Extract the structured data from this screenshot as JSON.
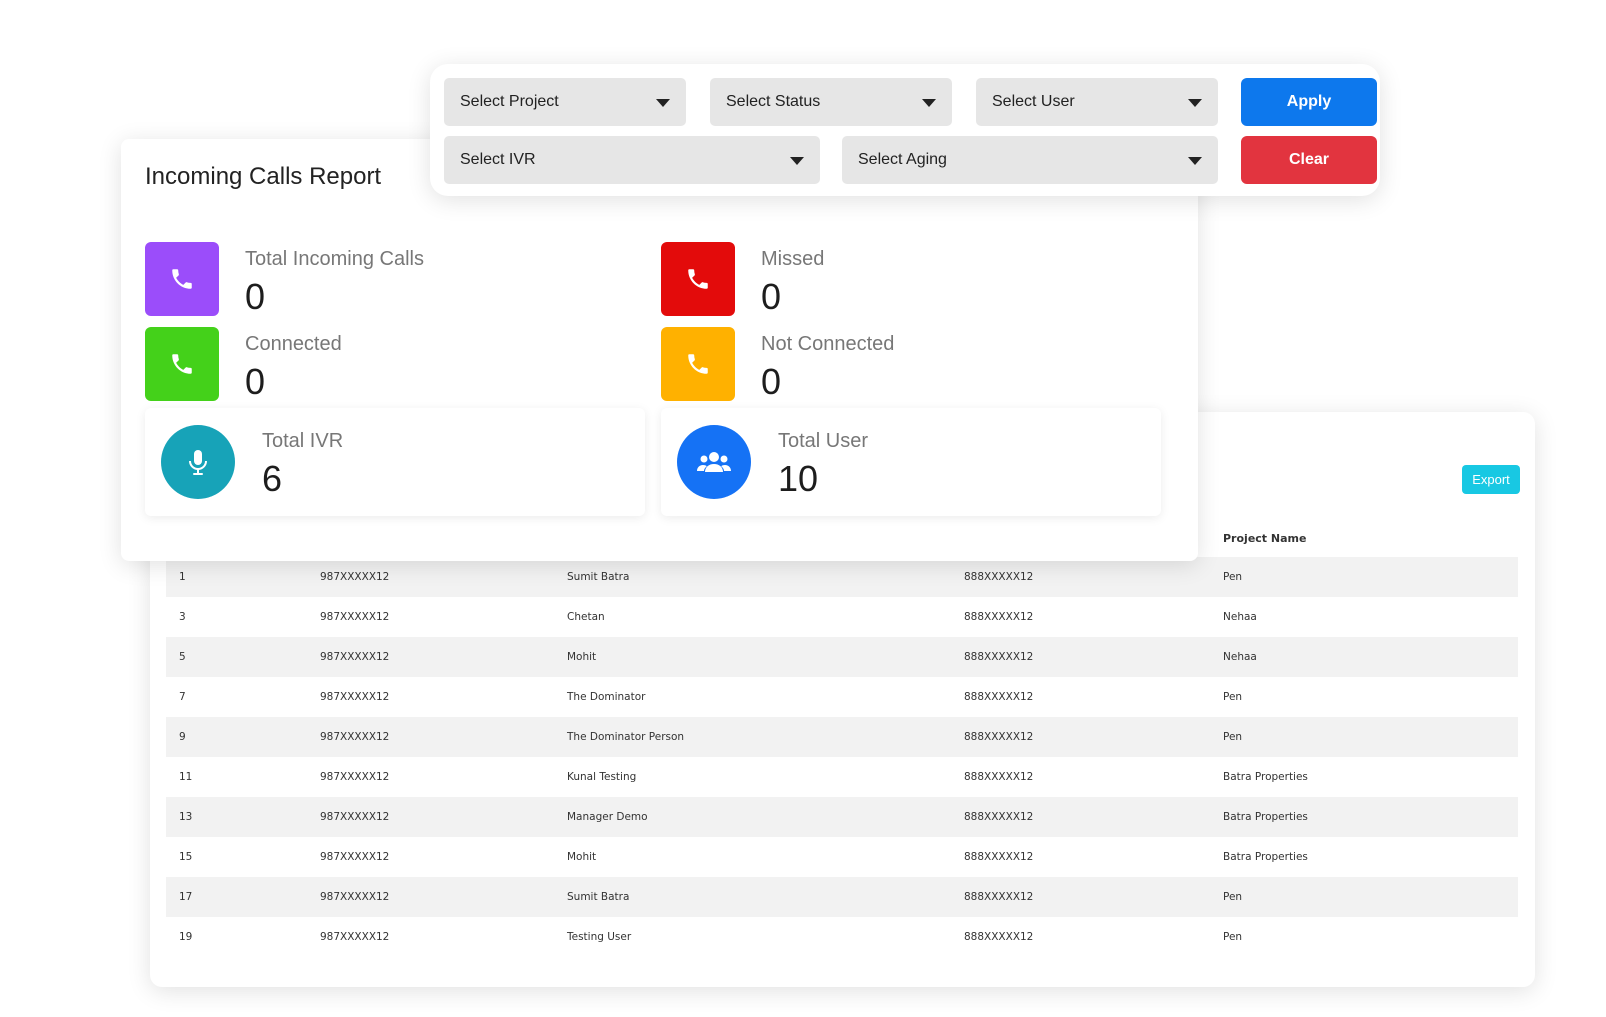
{
  "filters": {
    "project": "Select Project",
    "status": "Select Status",
    "user": "Select User",
    "ivr": "Select IVR",
    "aging": "Select Aging",
    "apply_label": "Apply",
    "clear_label": "Clear"
  },
  "report": {
    "title": "Incoming Calls Report",
    "stats": {
      "total_incoming": {
        "label": "Total Incoming Calls",
        "value": "0"
      },
      "missed": {
        "label": "Missed",
        "value": "0"
      },
      "connected": {
        "label": "Connected",
        "value": "0"
      },
      "not_connected": {
        "label": "Not Connected",
        "value": "0"
      },
      "total_ivr": {
        "label": "Total IVR",
        "value": "6"
      },
      "total_user": {
        "label": "Total User",
        "value": "10"
      }
    }
  },
  "table": {
    "export_label": "Export",
    "header_project": "Project Name",
    "rows": [
      {
        "id": "1",
        "caller": "987XXXXX12",
        "name": "Sumit Batra",
        "number": "888XXXXX12",
        "project": "Pen"
      },
      {
        "id": "3",
        "caller": "987XXXXX12",
        "name": "Chetan",
        "number": "888XXXXX12",
        "project": "Nehaa"
      },
      {
        "id": "5",
        "caller": "987XXXXX12",
        "name": "Mohit",
        "number": "888XXXXX12",
        "project": "Nehaa"
      },
      {
        "id": "7",
        "caller": "987XXXXX12",
        "name": "The Dominator",
        "number": "888XXXXX12",
        "project": "Pen"
      },
      {
        "id": "9",
        "caller": "987XXXXX12",
        "name": "The Dominator Person",
        "number": "888XXXXX12",
        "project": "Pen"
      },
      {
        "id": "11",
        "caller": "987XXXXX12",
        "name": "Kunal Testing",
        "number": "888XXXXX12",
        "project": "Batra Properties"
      },
      {
        "id": "13",
        "caller": "987XXXXX12",
        "name": "Manager Demo",
        "number": "888XXXXX12",
        "project": "Batra Properties"
      },
      {
        "id": "15",
        "caller": "987XXXXX12",
        "name": "Mohit",
        "number": "888XXXXX12",
        "project": "Batra Properties"
      },
      {
        "id": "17",
        "caller": "987XXXXX12",
        "name": "Sumit Batra",
        "number": "888XXXXX12",
        "project": "Pen"
      },
      {
        "id": "19",
        "caller": "987XXXXX12",
        "name": "Testing User",
        "number": "888XXXXX12",
        "project": "Pen"
      }
    ]
  },
  "colors": {
    "purple": "#9b4dfa",
    "red": "#e30b0b",
    "green": "#44d11a",
    "orange": "#ffb100",
    "teal": "#17a3b8",
    "blue": "#1572f5",
    "apply": "#0d78ed",
    "clear": "#e2343f",
    "export": "#18c8e3"
  },
  "icons": {
    "stat_call": "phone-icon",
    "ivr": "microphone-icon",
    "users": "users-icon",
    "dropdown": "caret-down-icon"
  }
}
